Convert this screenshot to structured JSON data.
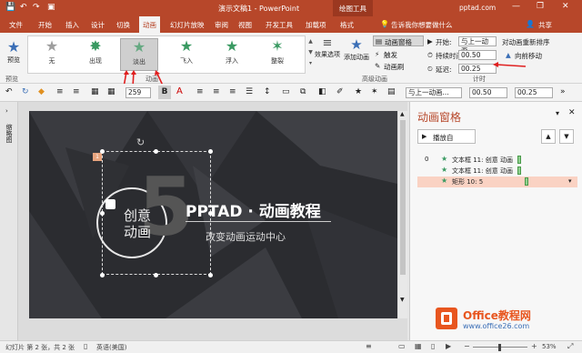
{
  "titlebar": {
    "title": "演示文稿1 - PowerPoint",
    "context_tool": "绘图工具",
    "account": "pptad.com",
    "window_controls": [
      "minimize-icon",
      "restore-icon",
      "close-icon"
    ]
  },
  "tabs": [
    {
      "label": "文件"
    },
    {
      "label": "开始"
    },
    {
      "label": "插入"
    },
    {
      "label": "设计"
    },
    {
      "label": "切换"
    },
    {
      "label": "动画"
    },
    {
      "label": "幻灯片放映"
    },
    {
      "label": "审阅"
    },
    {
      "label": "视图"
    },
    {
      "label": "开发工具"
    },
    {
      "label": "加载项"
    },
    {
      "label": "格式"
    }
  ],
  "tell_me": "告诉我你想要做什么",
  "share": "共享",
  "ribbon": {
    "preview": "预览",
    "preview_group": "预览",
    "animations": [
      {
        "label": "无",
        "color": "#9e9e9e"
      },
      {
        "label": "出现",
        "color": "#3a9a62"
      },
      {
        "label": "淡出",
        "color": "#3a9a62"
      },
      {
        "label": "飞入",
        "color": "#3a9a62"
      },
      {
        "label": "浮入",
        "color": "#3a9a62"
      },
      {
        "label": "整裂",
        "color": "#3a9a62"
      }
    ],
    "animations_group": "动画",
    "effect_options": "效果选项",
    "add_animation": "添加动画",
    "advanced_group": "高级动画",
    "animation_pane": "动画窗格",
    "trigger": "触发",
    "animation_painter": "动画刷",
    "start_label": "开始:",
    "start_value": "与上一动画...",
    "duration_label": "持续时间:",
    "duration_value": "00.50",
    "delay_label": "延迟:",
    "delay_value": "00.25",
    "reorder_title": "对动画重新排序",
    "move_earlier": "向前移动",
    "timing_group": "计时"
  },
  "format_bar": {
    "font_size": "259",
    "start_value": "与上一动画...",
    "duration_value": "00.50",
    "delay_value": "00.25"
  },
  "slide": {
    "tag_number": "1",
    "badge_line1": "创意",
    "badge_line2": "动画",
    "big_number": "5",
    "title": "PPTAD · 动画教程",
    "subtitle": "改变动画运动中心"
  },
  "left_strip": {
    "label": "缩略图"
  },
  "pane": {
    "title": "动画窗格",
    "play_from": "播放自",
    "items": [
      {
        "index": "0",
        "label": "文本框 11: 创意 动画"
      },
      {
        "index": "",
        "label": "文本框 11: 创意 动画"
      },
      {
        "index": "",
        "label": "矩形 10: 5"
      }
    ]
  },
  "status": {
    "slide_info": "幻灯片 第 2 张，共 2 张",
    "language": "英语(美国)",
    "zoom": "53%"
  },
  "watermark": {
    "text": "Office教程网",
    "url": "www.office26.com"
  },
  "colors": {
    "accent": "#b7472a",
    "anim_green": "#3a9a62",
    "selected_row": "#fad2c3",
    "arrow_red": "#e02020"
  }
}
